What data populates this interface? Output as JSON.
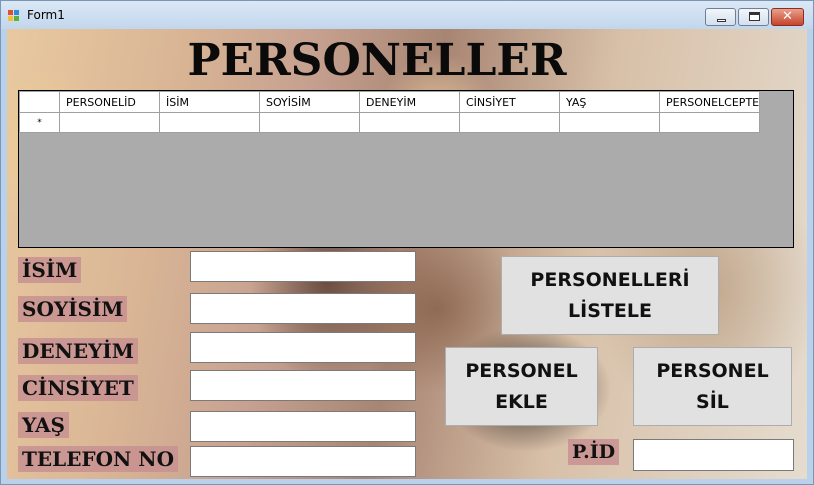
{
  "window": {
    "title": "Form1"
  },
  "header": {
    "title": "PERSONELLER"
  },
  "grid": {
    "columns": [
      "PERSONELİD",
      "İSİM",
      "SOYİSİM",
      "DENEYİM",
      "CİNSİYET",
      "YAŞ",
      "PERSONELCEPTE"
    ],
    "new_row_marker": "*"
  },
  "form": {
    "labels": {
      "isim": "İSİM",
      "soyisim": "SOYİSİM",
      "deneyim": "DENEYİM",
      "cinsiyet": "CİNSİYET",
      "yas": "YAŞ",
      "telefon": "TELEFON NO",
      "pid": "P.İD"
    },
    "values": {
      "isim": "",
      "soyisim": "",
      "deneyim": "",
      "cinsiyet": "",
      "yas": "",
      "telefon": "",
      "pid": ""
    }
  },
  "buttons": {
    "listele": "PERSONELLERİ\nLİSTELE",
    "ekle": "PERSONEL\nEKLE",
    "sil": "PERSONEL\nSİL"
  },
  "colors": {
    "label_bg": "#c89191",
    "grid_bg": "#ababab",
    "button_bg": "#e1e1e1"
  }
}
